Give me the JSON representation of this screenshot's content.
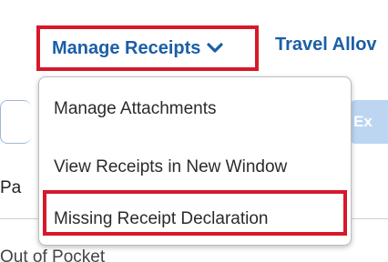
{
  "nav": {
    "manage_receipts_label": "Manage Receipts",
    "travel_label": "Travel Allov"
  },
  "background": {
    "left_fragment": "Pa",
    "right_button_fragment": "Ex",
    "bottom_fragment": "Out of Pocket"
  },
  "dropdown": {
    "items": [
      {
        "label": "Manage Attachments"
      },
      {
        "label": "View Receipts in New Window"
      },
      {
        "label": "Missing Receipt Declaration"
      }
    ]
  },
  "colors": {
    "link_blue": "#1b5ea6",
    "highlight_red": "#d7182a",
    "button_blue_light": "#bcd6f2"
  },
  "icons": {
    "dropdown_chevron": "chevron-down-icon"
  }
}
